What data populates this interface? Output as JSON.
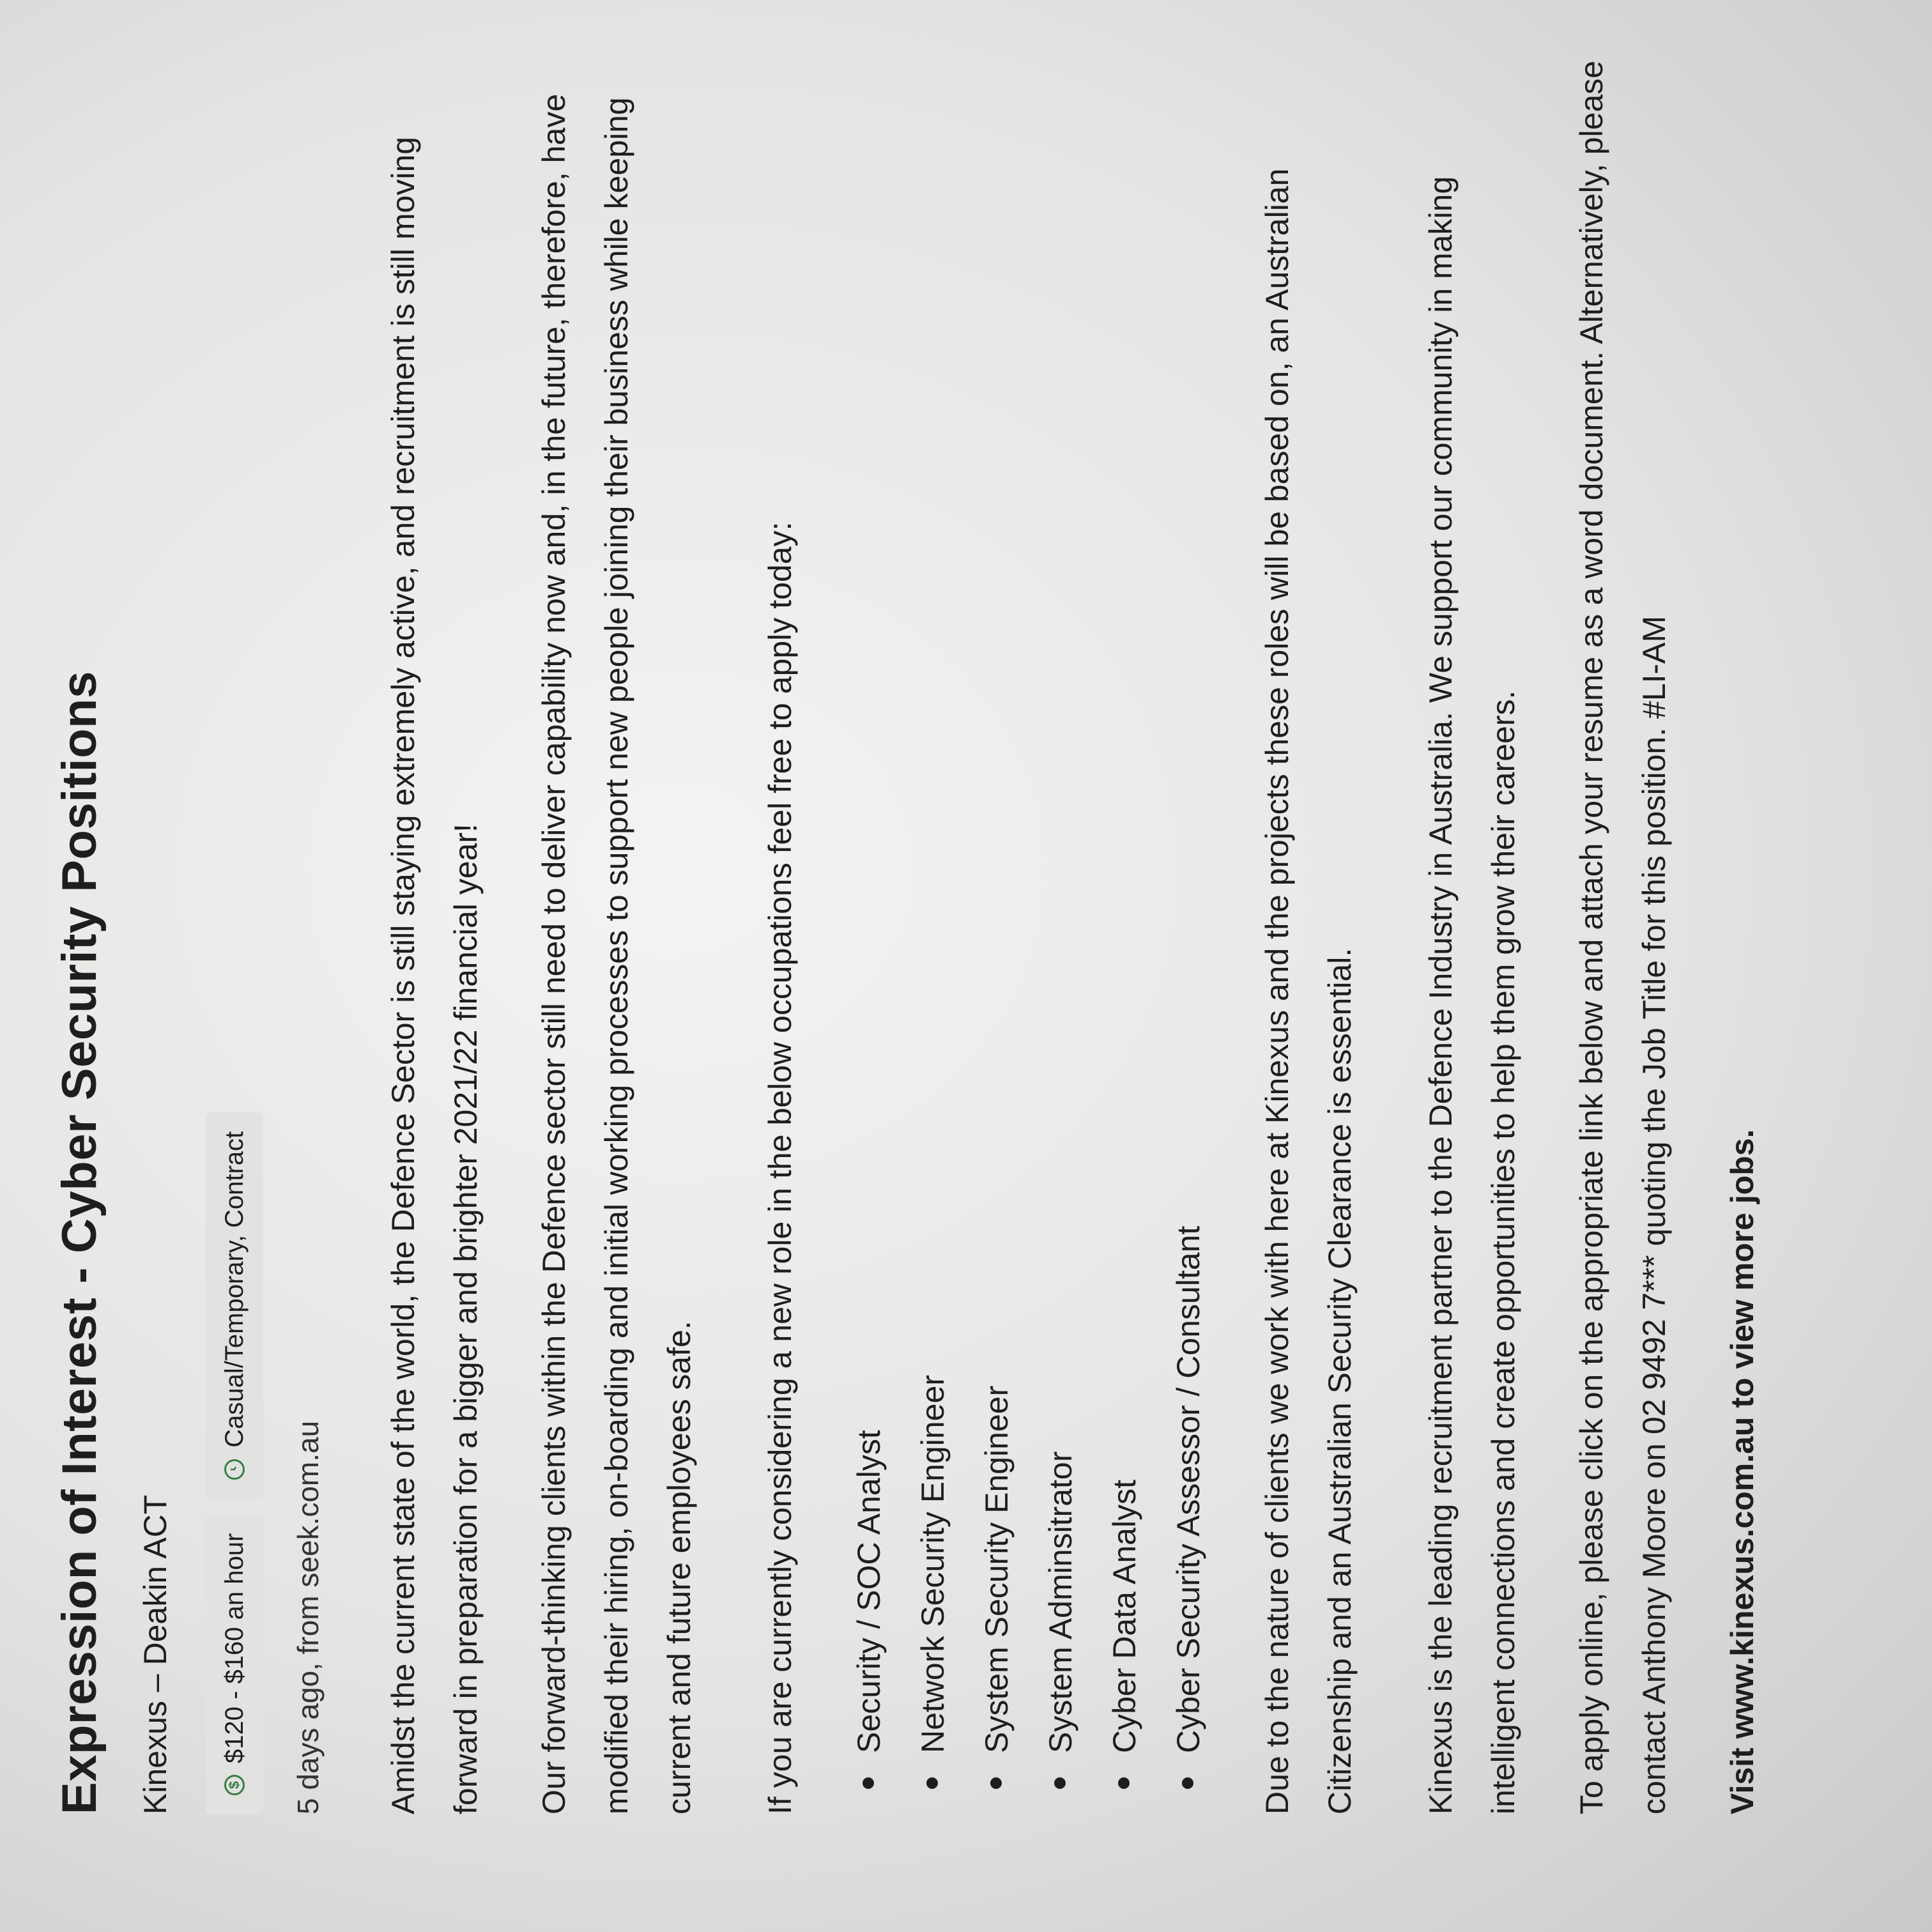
{
  "job": {
    "title": "Expression of Interest - Cyber Security Positions",
    "company_location": "Kinexus – Deakin ACT",
    "salary": "$120 - $160 an hour",
    "work_type": "Casual/Temporary, Contract",
    "posted": "5 days ago, from seek.com.au"
  },
  "description": {
    "para1": "Amidst the current state of the world, the Defence Sector is still staying extremely active, and recruitment is still moving forward in preparation for a bigger and brighter 2021/22 financial year!",
    "para2": "Our forward-thinking clients within the Defence sector still need to deliver capability now and, in the future, therefore, have modified their hiring, on-boarding and initial working processes to support new people joining their business while keeping current and future employees safe.",
    "para3": "If you are currently considering a new role in the below occupations feel free to apply today:",
    "roles": [
      "Security / SOC Analyst",
      "Network Security Engineer",
      "System Security Engineer",
      "System Adminsitrator",
      "Cyber Data Analyst",
      "Cyber Security Assessor / Consultant"
    ],
    "para4": "Due to the nature of clients we work with here at Kinexus and the projects these roles will be based on, an Australian Citizenship and an Australian Security Clearance is essential.",
    "para5": "Kinexus is the leading recruitment partner to the Defence Industry in Australia. We support our community in making intelligent connections and create opportunities to help them grow their careers.",
    "para6": "To apply online, please click on the appropriate link below and attach your resume as a word document. Alternatively, please contact Anthony Moore on 02 9492 7*** quoting the Job Title for this position. #LI-AM",
    "visit": "Visit www.kinexus.com.au to view more jobs."
  },
  "icons": {
    "salary": "dollar-circle-icon",
    "work_type": "clock-icon"
  },
  "colors": {
    "accent": "#3a7d44",
    "chip_bg": "#e2e2e0",
    "text": "#1e1e1e"
  }
}
